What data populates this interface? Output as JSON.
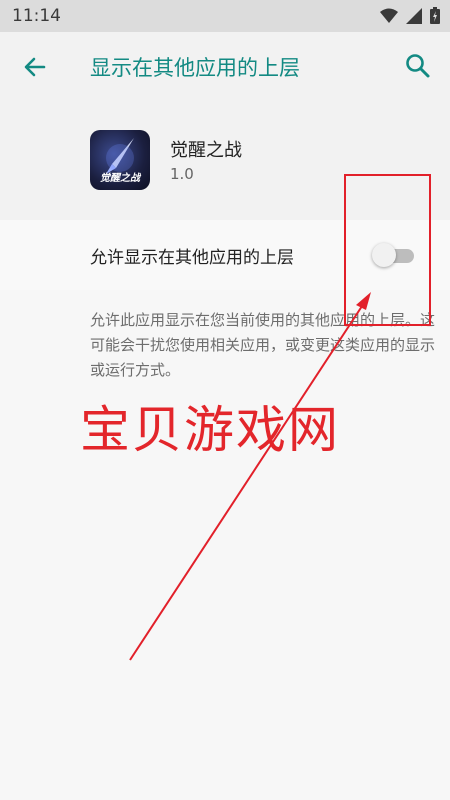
{
  "status_bar": {
    "time": "11:14"
  },
  "app_bar": {
    "title": "显示在其他应用的上层"
  },
  "app": {
    "name": "觉醒之战",
    "version": "1.0",
    "icon_text": "觉醒之战"
  },
  "setting": {
    "label": "允许显示在其他应用的上层",
    "toggle_on": false
  },
  "description": "允许此应用显示在您当前使用的其他应用的上层。这可能会干扰您使用相关应用，或变更这类应用的显示或运行方式。",
  "watermark": "宝贝游戏网",
  "colors": {
    "accent": "#138a83",
    "annotation": "#e2202a"
  }
}
